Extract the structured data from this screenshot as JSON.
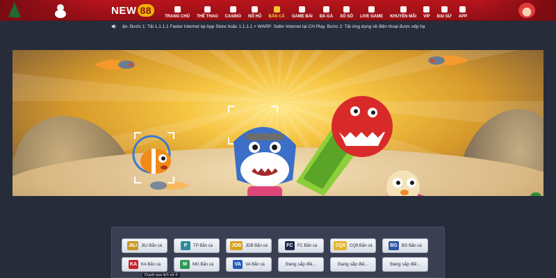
{
  "brand": {
    "name": "NEW",
    "number": "88"
  },
  "nav": {
    "items": [
      {
        "label": "TRANG CHỦ",
        "icon": "home-icon"
      },
      {
        "label": "THỂ THAO",
        "icon": "ball-icon"
      },
      {
        "label": "CASINO",
        "icon": "chip-icon"
      },
      {
        "label": "NỔ HŨ",
        "icon": "slot-icon"
      },
      {
        "label": "BẮN CÁ",
        "icon": "fish-icon",
        "active": true
      },
      {
        "label": "GAME BÀI",
        "icon": "cards-icon"
      },
      {
        "label": "ĐÁ GÀ",
        "icon": "rooster-icon"
      },
      {
        "label": "XỔ SỐ",
        "icon": "lottery-icon"
      },
      {
        "label": "LIVE GAME",
        "icon": "live-icon"
      },
      {
        "label": "KHUYẾN MÃI",
        "icon": "gift-icon"
      },
      {
        "label": "VIP",
        "icon": "crown-icon"
      },
      {
        "label": "ĐẠI SỨ",
        "icon": "ambassador-icon"
      },
      {
        "label": "APP",
        "icon": "app-icon"
      }
    ]
  },
  "marquee": {
    "text": "ận:  Bước 1: Tải 1.1.1.1 Faster Internet tại App Store hoặc 1.1.1.1 + WARP: Safer Internet tại CH Play.  Bước 2: Tải ứng dụng về điện thoại được xếp hạ"
  },
  "providers": [
    {
      "logo": "JILI",
      "label": "JILI Bắn cá",
      "color": "#c7982a"
    },
    {
      "logo": "P",
      "label": "TP Bắn cá",
      "color": "#2e8b9a"
    },
    {
      "logo": "JDB",
      "label": "JDB Bắn cá",
      "color": "#d8a11e"
    },
    {
      "logo": "FC",
      "label": "FC Bắn cá",
      "color": "#1c2a4a"
    },
    {
      "logo": "CQ9",
      "label": "CQ9 Bắn cá",
      "color": "#e0b530"
    },
    {
      "logo": "BG",
      "label": "BG Bắn cá",
      "color": "#2f56a8"
    },
    {
      "logo": "KA",
      "label": "KA Bắn cá",
      "color": "#c8232b"
    },
    {
      "logo": "M",
      "label": "MG Bắn cá",
      "color": "#2f9a5a"
    },
    {
      "logo": "VA",
      "label": "VA Bắn cá",
      "color": "#2a5fb8"
    },
    {
      "logo": "",
      "label": "Đang sắp điề...",
      "color": ""
    },
    {
      "logo": "",
      "label": "Đang sắp điề...",
      "color": ""
    },
    {
      "logo": "",
      "label": "Đang sắp điề...",
      "color": ""
    }
  ],
  "tooltip": {
    "text": "Duyệt qua lịch sử ở"
  }
}
